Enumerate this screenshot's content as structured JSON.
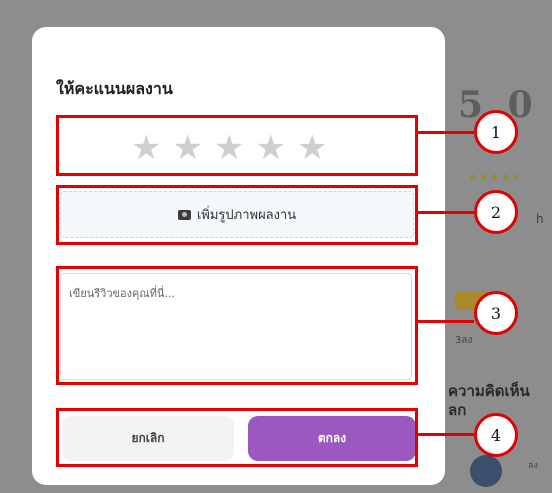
{
  "background": {
    "rating_text": "5.0",
    "stars_text": "★★★★★",
    "text1": "h",
    "text2": "3ลง",
    "heading": "ความคิดเห็น\nลก",
    "text3": "ลง"
  },
  "modal": {
    "title": "ให้คะแนนผลงาน",
    "stars": [
      "★",
      "★",
      "★",
      "★",
      "★"
    ],
    "upload_label": "เพิ่มรูปภาพผลงาน",
    "review_placeholder": "เขียนรีวิวของคุณที่นี่...",
    "cancel_label": "ยกเลิก",
    "ok_label": "ตกลง"
  },
  "annotations": [
    "1",
    "2",
    "3",
    "4"
  ],
  "colors": {
    "accent": "#9b59c0",
    "annotation": "#e20000"
  }
}
